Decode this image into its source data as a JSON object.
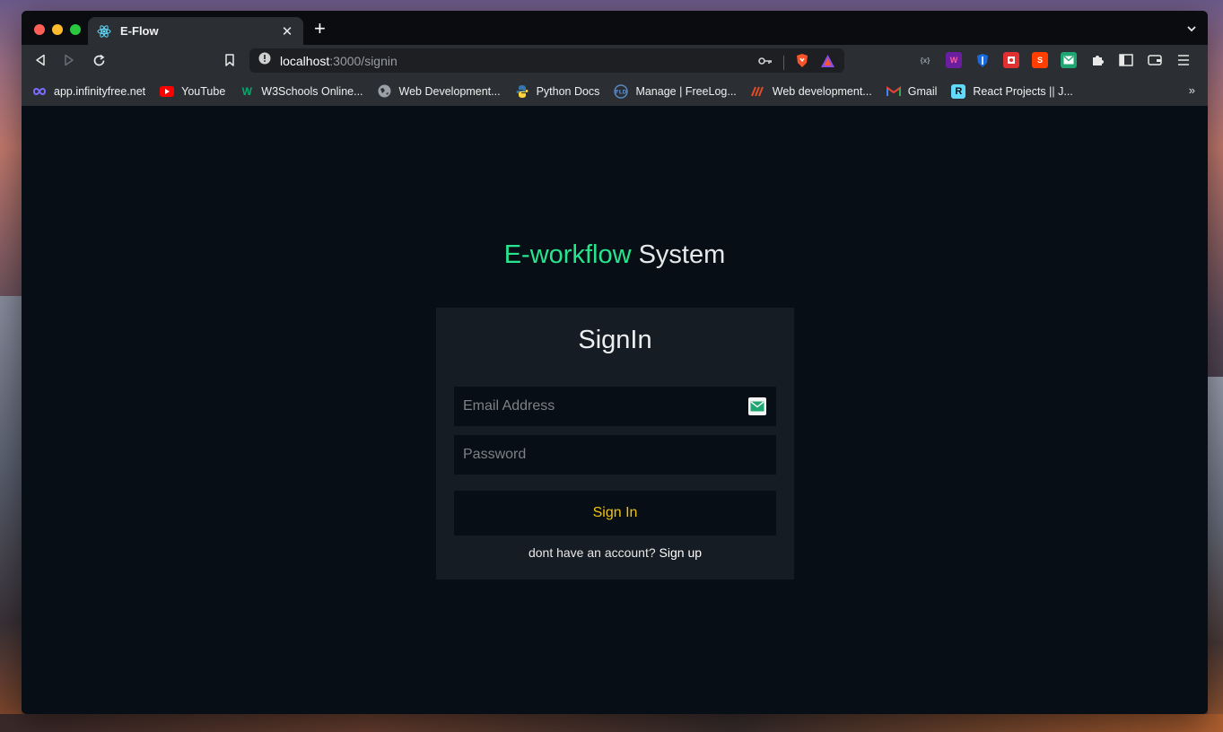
{
  "browser": {
    "tab_title": "E-Flow",
    "tab_close": "✕",
    "new_tab": "+",
    "url_host": "localhost",
    "url_path": ":3000/signin",
    "bookmarks": [
      {
        "label": "app.infinityfree.net",
        "icon": "infinity-icon",
        "color": "#7a6cff"
      },
      {
        "label": "YouTube",
        "icon": "youtube-icon",
        "color": "#ff0000"
      },
      {
        "label": "W3Schools Online...",
        "icon": "w3schools-icon",
        "color": "#04aa6d"
      },
      {
        "label": "Web Development...",
        "icon": "globe-icon",
        "color": "#9aa0a6"
      },
      {
        "label": "Python Docs",
        "icon": "python-icon",
        "color": "#3776ab"
      },
      {
        "label": "Manage | FreeLog...",
        "icon": "freelogo-icon",
        "color": "#5a8ac0"
      },
      {
        "label": "Web development...",
        "icon": "mdn-icon",
        "color": "#e44d26"
      },
      {
        "label": "Gmail",
        "icon": "gmail-icon",
        "color": "#ea4335"
      },
      {
        "label": "React Projects || J...",
        "icon": "react-projects-icon",
        "color": "#61dafb"
      }
    ],
    "bookmarks_more": "»",
    "extensions": [
      {
        "name": "code-ext-icon",
        "text": "{x}",
        "bg": "#2b2e33",
        "color": "#9aa0a6"
      },
      {
        "name": "wf-ext-icon",
        "text": "W",
        "bg": "#6a1fa0",
        "color": "#ff5a9a"
      },
      {
        "name": "shield-ext-icon",
        "text": "",
        "bg": "#1a6adf",
        "color": "#fff"
      },
      {
        "name": "puzzle-red-ext-icon",
        "text": "",
        "bg": "#e03030",
        "color": "#fff"
      },
      {
        "name": "svelte-ext-icon",
        "text": "S",
        "bg": "#ff3e00",
        "color": "#fff"
      },
      {
        "name": "mail-ext-icon",
        "text": "",
        "bg": "#1ea672",
        "color": "#fff"
      }
    ]
  },
  "page": {
    "title_accent": "E-workflow",
    "title_rest": " System",
    "card_title": "SignIn",
    "email_placeholder": "Email Address",
    "password_placeholder": "Password",
    "signin_label": "Sign In",
    "signup_prompt": "dont have an account? ",
    "signup_link": "Sign up"
  },
  "colors": {
    "accent": "#27e58f",
    "button_text": "#f1c40f",
    "page_bg": "#070e15",
    "card_bg": "#161c23"
  }
}
